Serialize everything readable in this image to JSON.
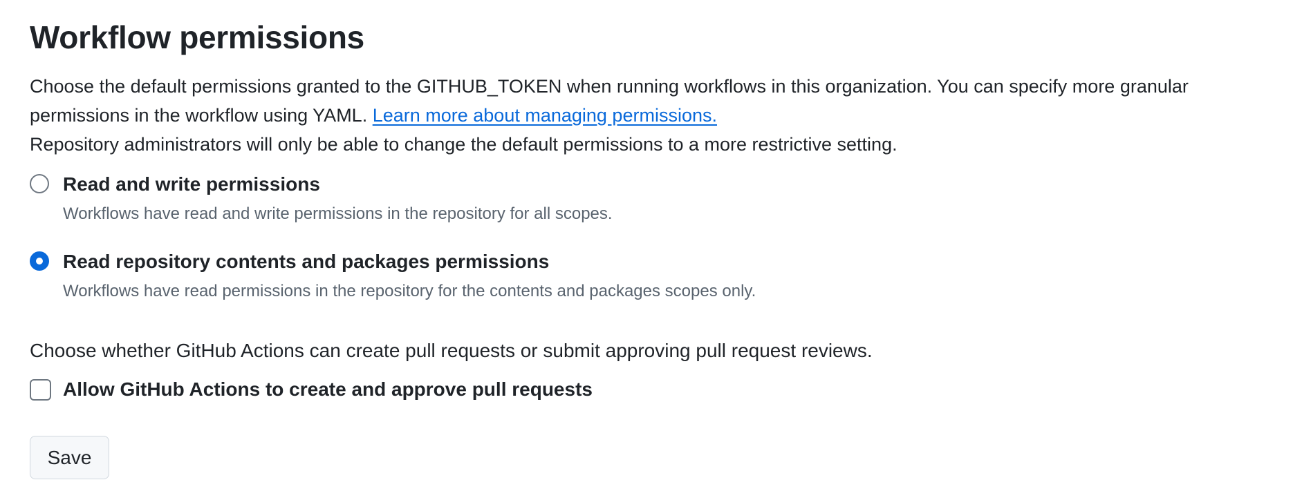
{
  "section": {
    "title": "Workflow permissions",
    "description_line1": "Choose the default permissions granted to the GITHUB_TOKEN when running workflows in this organization. You can specify more granular",
    "description_line2_prefix": "permissions in the workflow using YAML. ",
    "learn_more_link": "Learn more about managing permissions.",
    "admin_note": "Repository administrators will only be able to change the default permissions to a more restrictive setting."
  },
  "permission_options": [
    {
      "label": "Read and write permissions",
      "description": "Workflows have read and write permissions in the repository for all scopes.",
      "selected": false
    },
    {
      "label": "Read repository contents and packages permissions",
      "description": "Workflows have read permissions in the repository for the contents and packages scopes only.",
      "selected": true
    }
  ],
  "pull_requests": {
    "prompt": "Choose whether GitHub Actions can create pull requests or submit approving pull request reviews.",
    "checkbox_label": "Allow GitHub Actions to create and approve pull requests",
    "checked": false
  },
  "actions": {
    "save_label": "Save"
  },
  "colors": {
    "accent": "#0969da",
    "text": "#1f2328",
    "muted": "#59636e",
    "border": "#6e7781"
  }
}
